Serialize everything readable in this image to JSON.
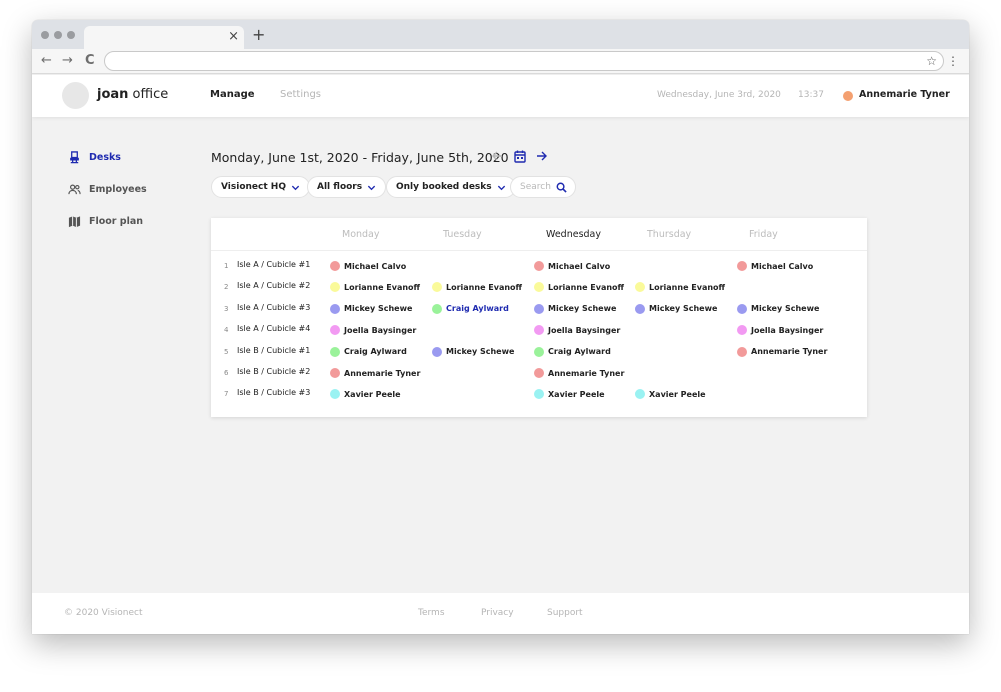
{
  "browser": {
    "tab_close": "×",
    "new_tab": "+",
    "back": "←",
    "forward": "→",
    "reload": "C",
    "star": "☆",
    "menu": "⋮"
  },
  "header": {
    "brand_bold": "joan",
    "brand_rest": " office",
    "nav_manage": "Manage",
    "nav_settings": "Settings",
    "date": "Wednesday, June 3rd, 2020",
    "time": "13:37",
    "user_name": "Annemarie Tyner",
    "user_color": "#f4a070"
  },
  "sidebar": {
    "items": [
      {
        "label": "Desks",
        "icon": "chair-icon",
        "active": true
      },
      {
        "label": "Employees",
        "icon": "people-icon",
        "active": false
      },
      {
        "label": "Floor plan",
        "icon": "map-icon",
        "active": false
      }
    ]
  },
  "main": {
    "range_title": "Monday, June 1st, 2020 - Friday, June 5th, 2020",
    "filters": {
      "location": "Visionect HQ",
      "floors": "All floors",
      "booked": "Only booked desks"
    },
    "search_placeholder": "Search"
  },
  "table": {
    "days": [
      "Monday",
      "Tuesday",
      "Wednesday",
      "Thursday",
      "Friday"
    ],
    "today_index": 2,
    "rows": [
      {
        "num": "1",
        "desk": "Isle A / Cubicle #1",
        "cells": [
          {
            "name": "Michael Calvo",
            "color": "#f29a9a"
          },
          null,
          {
            "name": "Michael Calvo",
            "color": "#f29a9a"
          },
          null,
          {
            "name": "Michael Calvo",
            "color": "#f29a9a"
          }
        ]
      },
      {
        "num": "2",
        "desk": "Isle A / Cubicle #2",
        "cells": [
          {
            "name": "Lorianne Evanoff",
            "color": "#fafa9a"
          },
          {
            "name": "Lorianne Evanoff",
            "color": "#fafa9a"
          },
          {
            "name": "Lorianne Evanoff",
            "color": "#fafa9a"
          },
          {
            "name": "Lorianne Evanoff",
            "color": "#fafa9a"
          },
          null
        ]
      },
      {
        "num": "3",
        "desk": "Isle A / Cubicle #3",
        "cells": [
          {
            "name": "Mickey Schewe",
            "color": "#9a9af0"
          },
          {
            "name": "Craig Aylward",
            "color": "#9af29a",
            "link": true
          },
          {
            "name": "Mickey Schewe",
            "color": "#9a9af0"
          },
          {
            "name": "Mickey Schewe",
            "color": "#9a9af0"
          },
          {
            "name": "Mickey Schewe",
            "color": "#9a9af0"
          }
        ]
      },
      {
        "num": "4",
        "desk": "Isle A / Cubicle #4",
        "cells": [
          {
            "name": "Joella Baysinger",
            "color": "#f29af2"
          },
          null,
          {
            "name": "Joella Baysinger",
            "color": "#f29af2"
          },
          null,
          {
            "name": "Joella Baysinger",
            "color": "#f29af2"
          }
        ]
      },
      {
        "num": "5",
        "desk": "Isle B / Cubicle #1",
        "cells": [
          {
            "name": "Craig Aylward",
            "color": "#9af29a"
          },
          {
            "name": "Mickey Schewe",
            "color": "#9a9af0"
          },
          {
            "name": "Craig Aylward",
            "color": "#9af29a"
          },
          null,
          {
            "name": "Annemarie Tyner",
            "color": "#f29a9a"
          }
        ]
      },
      {
        "num": "6",
        "desk": "Isle B / Cubicle #2",
        "cells": [
          {
            "name": "Annemarie Tyner",
            "color": "#f29a9a"
          },
          null,
          {
            "name": "Annemarie Tyner",
            "color": "#f29a9a"
          },
          null,
          null
        ]
      },
      {
        "num": "7",
        "desk": "Isle B / Cubicle #3",
        "cells": [
          {
            "name": "Xavier Peele",
            "color": "#9af2f2"
          },
          null,
          {
            "name": "Xavier Peele",
            "color": "#9af2f2"
          },
          {
            "name": "Xavier Peele",
            "color": "#9af2f2"
          },
          null
        ]
      }
    ]
  },
  "footer": {
    "copyright": "© 2020 Visionect",
    "links": [
      "Terms",
      "Privacy",
      "Support"
    ]
  },
  "colors": {
    "accent": "#1f2bb0",
    "muted": "#b5b5b5"
  }
}
